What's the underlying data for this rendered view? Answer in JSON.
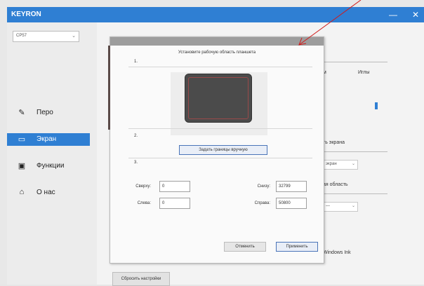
{
  "app": {
    "title": "KEYRON",
    "minimize_glyph": "—",
    "close_glyph": "✕"
  },
  "sidebar": {
    "device": "CP57",
    "items": [
      {
        "icon": "pen-icon",
        "glyph": "✎",
        "label": "Перо"
      },
      {
        "icon": "screen-icon",
        "glyph": "▭",
        "label": "Экран"
      },
      {
        "icon": "function-icon",
        "glyph": "▣",
        "label": "Функции"
      },
      {
        "icon": "home-icon",
        "glyph": "⌂",
        "label": "О нас"
      }
    ],
    "active_index": 1
  },
  "background": {
    "right_labels": [
      "м",
      "Иглы",
      "ть экрана",
      "экран",
      "ая область",
      "—",
      "Windows Ink"
    ],
    "reset_button": "Сбросить настройки"
  },
  "dialog": {
    "title": "Установите рабочую область планшета",
    "steps": [
      "1.",
      "2.",
      "3."
    ],
    "show_button": "Задать границы вручную",
    "fields": {
      "top": {
        "label": "Сверху:",
        "value": "0"
      },
      "left": {
        "label": "Слева:",
        "value": "0"
      },
      "bottom": {
        "label": "Снизу:",
        "value": "32799"
      },
      "right": {
        "label": "Справа:",
        "value": "50800"
      }
    },
    "cancel": "Отменить",
    "apply": "Применить"
  },
  "colors": {
    "accent": "#2f7fd3",
    "annotation": "#d11a1a"
  }
}
